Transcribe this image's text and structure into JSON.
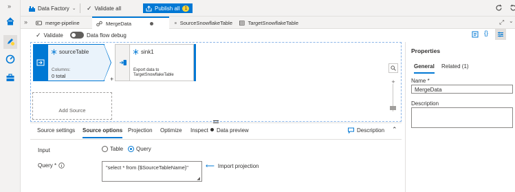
{
  "topbar": {
    "data_factory_label": "Data Factory",
    "validate_all_label": "Validate all",
    "publish_all_label": "Publish all",
    "publish_badge": "1"
  },
  "tabs": [
    {
      "label": "merge-pipeline"
    },
    {
      "label": "MergeData"
    },
    {
      "label": "SourceSnowflakeTable"
    },
    {
      "label": "TargetSnowflakeTable"
    }
  ],
  "toolbar": {
    "validate_label": "Validate",
    "debug_label": "Data flow debug"
  },
  "canvas": {
    "source_node": {
      "title": "sourceTable",
      "columns_label": "Columns:",
      "columns_value": "0 total"
    },
    "sink_node": {
      "title": "sink1",
      "description_line1": "Export data to",
      "description_line2": "TargetSnowflakeTable"
    },
    "add_source_label": "Add Source"
  },
  "bottom_tabs": [
    {
      "label": "Source settings"
    },
    {
      "label": "Source options"
    },
    {
      "label": "Projection"
    },
    {
      "label": "Optimize"
    },
    {
      "label": "Inspect"
    },
    {
      "label": "Data preview"
    }
  ],
  "description_button_label": "Description",
  "source_options": {
    "input_label": "Input",
    "input_options": [
      "Table",
      "Query"
    ],
    "input_selected": "Query",
    "query_label": "Query *",
    "query_value": "\"select * from {$SourceTableName}\"",
    "import_projection_label": "Import projection"
  },
  "properties": {
    "title": "Properties",
    "tabs": [
      "General",
      "Related (1)"
    ],
    "name_label": "Name *",
    "name_value": "MergeData",
    "description_label": "Description",
    "description_value": ""
  },
  "colors": {
    "accent": "#0078d4",
    "badge": "#ffd335"
  }
}
